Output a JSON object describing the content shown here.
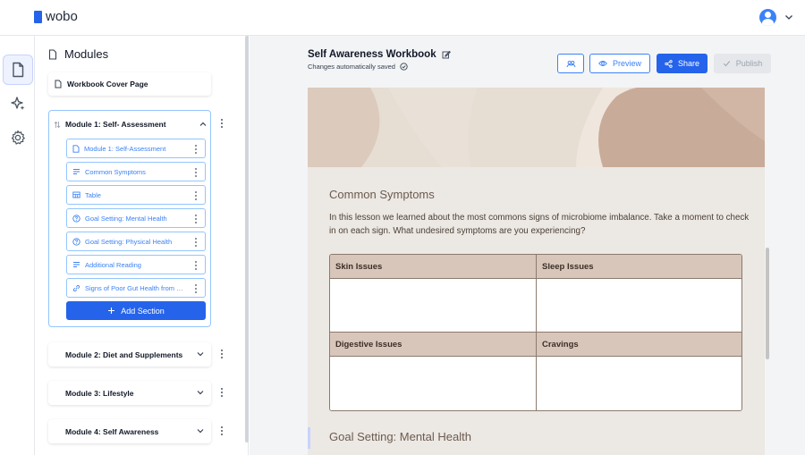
{
  "app": {
    "logo_text": "wobo",
    "brand_color": "#2563eb"
  },
  "rail": {
    "items": [
      "document-icon",
      "sparkle-icon",
      "gear-icon"
    ],
    "active": "document-icon"
  },
  "modules_panel": {
    "title": "Modules",
    "cover_page": "Workbook Cover Page",
    "module1": {
      "title": "Module 1: Self- Assessment",
      "sections": [
        {
          "label": "Module 1: Self-Assessment",
          "icon": "page-icon"
        },
        {
          "label": "Common Symptoms",
          "icon": "text-lines-icon"
        },
        {
          "label": "Table",
          "icon": "table-icon"
        },
        {
          "label": "Goal Setting: Mental Health",
          "icon": "question-icon"
        },
        {
          "label": "Goal Setting: Physical Health",
          "icon": "question-icon"
        },
        {
          "label": "Additional Reading",
          "icon": "text-lines-icon"
        },
        {
          "label": "Signs of Poor Gut Health from a ...",
          "icon": "link-icon"
        }
      ],
      "add_section_label": "Add Section"
    },
    "other_modules": [
      "Module 2: Diet and Supplements",
      "Module 3: Lifestyle",
      "Module 4: Self Awareness"
    ]
  },
  "editor": {
    "title": "Self Awareness Workbook",
    "saved_status": "Changes automatically saved",
    "buttons": {
      "preview": "Preview",
      "share": "Share",
      "publish": "Publish"
    },
    "lesson": {
      "title": "Common Symptoms",
      "text": "In this lesson we learned about the most commons signs of microbiome imbalance. Take a moment to check in on each sign. What undesired symptoms are you experiencing?",
      "table_headers": [
        "Skin Issues",
        "Sleep Issues",
        "Digestive Issues",
        "Cravings"
      ]
    },
    "next_section_title": "Goal Setting: Mental Health"
  }
}
